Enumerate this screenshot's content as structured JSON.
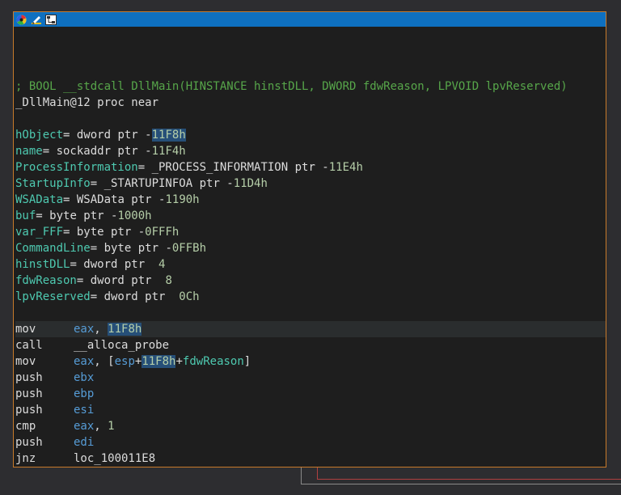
{
  "colors": {
    "titlebar": "#0e70c0",
    "frame": "#c87a2a",
    "background": "#1e1e1e",
    "comment": "#57a64a",
    "register": "#569cd6",
    "number": "#b5cea8",
    "variable": "#4ec9b0",
    "selection": "#264f78"
  },
  "toolbar": {
    "icons": [
      "color-wheel-icon",
      "edit-pencil-icon",
      "graph-view-icon"
    ]
  },
  "header": {
    "comment": "; BOOL __stdcall DllMain(HINSTANCE hinstDLL, DWORD fdwReason, LPVOID lpvReserved)",
    "proc_name": "_DllMain@12",
    "proc_kw": "proc near"
  },
  "vars": [
    {
      "name": "hObject",
      "type": "dword ptr ",
      "sign": "-",
      "offset": "11F8h",
      "selected": true
    },
    {
      "name": "name",
      "type": "sockaddr ptr ",
      "sign": "-",
      "offset": "11F4h",
      "selected": false
    },
    {
      "name": "ProcessInformation",
      "type": "_PROCESS_INFORMATION ptr ",
      "sign": "-",
      "offset": "11E4h",
      "selected": false
    },
    {
      "name": "StartupInfo",
      "type": "_STARTUPINFOA ptr ",
      "sign": "-",
      "offset": "11D4h",
      "selected": false
    },
    {
      "name": "WSAData",
      "type": "WSAData ptr ",
      "sign": "-",
      "offset": "1190h",
      "selected": false
    },
    {
      "name": "buf",
      "type": "byte ptr ",
      "sign": "-",
      "offset": "1000h",
      "selected": false
    },
    {
      "name": "var_FFF",
      "type": "byte ptr ",
      "sign": "-",
      "offset": "0FFFh",
      "selected": false
    },
    {
      "name": "CommandLine",
      "type": "byte ptr ",
      "sign": "-",
      "offset": "0FFBh",
      "selected": false
    },
    {
      "name": "hinstDLL",
      "type": "dword ptr  ",
      "sign": "",
      "offset": "4",
      "selected": false
    },
    {
      "name": "fdwReason",
      "type": "dword ptr  ",
      "sign": "",
      "offset": "8",
      "selected": false
    },
    {
      "name": "lpvReserved",
      "type": "dword ptr  ",
      "sign": "",
      "offset": "0Ch",
      "selected": false
    }
  ],
  "instructions": {
    "i0": {
      "mnem": "mov",
      "reg": "eax",
      "sep": ", ",
      "imm": "11F8h"
    },
    "i1": {
      "mnem": "call",
      "target": "__alloca_probe"
    },
    "i2": {
      "mnem": "mov",
      "reg": "eax",
      "p1": ", [",
      "base": "esp",
      "plus1": "+",
      "imm": "11F8h",
      "plus2": "+",
      "var": "fdwReason",
      "close": "]"
    },
    "i3": {
      "mnem": "push",
      "reg": "ebx"
    },
    "i4": {
      "mnem": "push",
      "reg": "ebp"
    },
    "i5": {
      "mnem": "push",
      "reg": "esi"
    },
    "i6": {
      "mnem": "cmp",
      "reg": "eax",
      "sep": ", ",
      "imm": "1"
    },
    "i7": {
      "mnem": "push",
      "reg": "edi"
    },
    "i8": {
      "mnem": "jnz",
      "target": "loc_100011E8"
    }
  }
}
